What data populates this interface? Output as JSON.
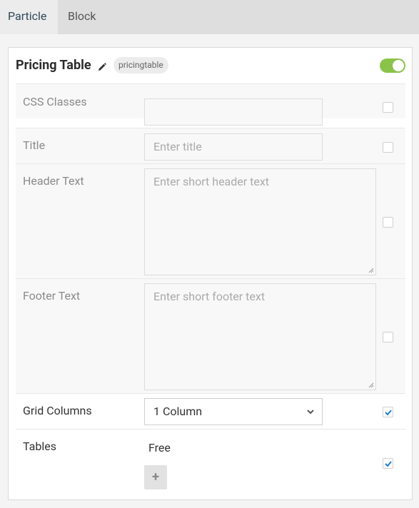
{
  "tabs": [
    {
      "label": "Particle",
      "active": true
    },
    {
      "label": "Block",
      "active": false
    }
  ],
  "panel": {
    "title": "Pricing Table",
    "badge": "pricingtable",
    "enabled": true
  },
  "fields": {
    "css_classes": {
      "label": "CSS Classes",
      "value": "",
      "placeholder": "",
      "checked": false
    },
    "title": {
      "label": "Title",
      "value": "",
      "placeholder": "Enter title",
      "checked": false
    },
    "header_text": {
      "label": "Header Text",
      "value": "",
      "placeholder": "Enter short header text",
      "checked": false
    },
    "footer_text": {
      "label": "Footer Text",
      "value": "",
      "placeholder": "Enter short footer text",
      "checked": false
    },
    "grid_columns": {
      "label": "Grid Columns",
      "value": "1 Column",
      "checked": true
    },
    "tables": {
      "label": "Tables",
      "items": [
        "Free"
      ],
      "add_label": "+",
      "checked": true
    }
  },
  "colors": {
    "accent_toggle": "#8bc34a",
    "checkbox_check": "#1e7ec8",
    "active_tab_text": "#2f4858"
  }
}
